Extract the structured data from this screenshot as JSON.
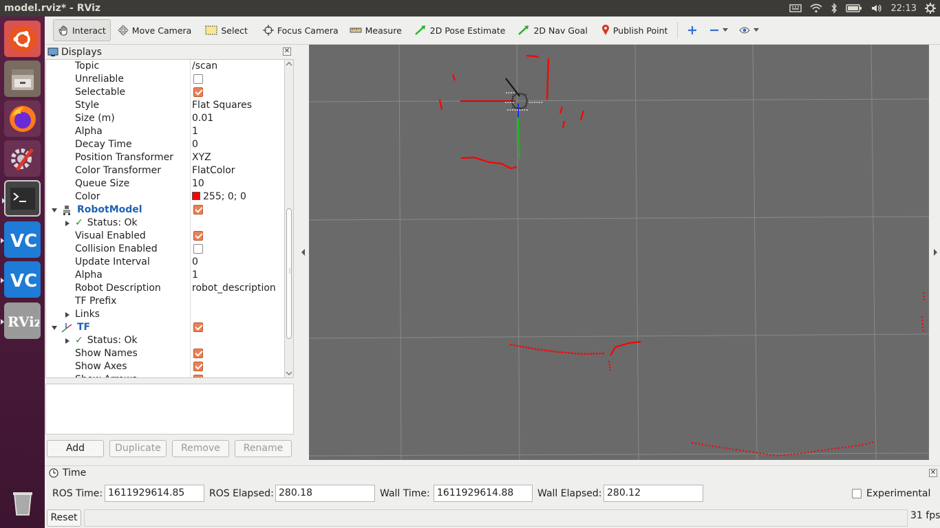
{
  "window": {
    "title": "model.rviz* - RViz"
  },
  "panel": {
    "clock": "22:13"
  },
  "toolbar": {
    "interact": "Interact",
    "move_camera": "Move Camera",
    "select": "Select",
    "focus_camera": "Focus Camera",
    "measure": "Measure",
    "pose_estimate": "2D Pose Estimate",
    "nav_goal": "2D Nav Goal",
    "publish_point": "Publish Point"
  },
  "displays": {
    "title": "Displays",
    "rows": [
      {
        "key": "Topic",
        "value": "/scan"
      },
      {
        "key": "Unreliable",
        "checked": false
      },
      {
        "key": "Selectable",
        "checked": true
      },
      {
        "key": "Style",
        "value": "Flat Squares"
      },
      {
        "key": "Size (m)",
        "value": "0.01"
      },
      {
        "key": "Alpha",
        "value": "1"
      },
      {
        "key": "Decay Time",
        "value": "0"
      },
      {
        "key": "Position Transformer",
        "value": "XYZ"
      },
      {
        "key": "Color Transformer",
        "value": "FlatColor"
      },
      {
        "key": "Queue Size",
        "value": "10"
      },
      {
        "key": "Color",
        "value": "255; 0; 0"
      },
      {
        "key": "RobotModel",
        "checked": true
      },
      {
        "key": "Status: Ok"
      },
      {
        "key": "Visual Enabled",
        "checked": true
      },
      {
        "key": "Collision Enabled",
        "checked": false
      },
      {
        "key": "Update Interval",
        "value": "0"
      },
      {
        "key": "Alpha",
        "value": "1"
      },
      {
        "key": "Robot Description",
        "value": "robot_description"
      },
      {
        "key": "TF Prefix",
        "value": ""
      },
      {
        "key": "Links"
      },
      {
        "key": "TF",
        "checked": true
      },
      {
        "key": "Status: Ok"
      },
      {
        "key": "Show Names",
        "checked": true
      },
      {
        "key": "Show Axes",
        "checked": true
      },
      {
        "key": "Show Arrows",
        "checked": true
      }
    ],
    "buttons": {
      "add": "Add",
      "duplicate": "Duplicate",
      "remove": "Remove",
      "rename": "Rename"
    }
  },
  "time": {
    "title": "Time",
    "ros_time_label": "ROS Time:",
    "ros_time": "1611929614.85",
    "ros_elapsed_label": "ROS Elapsed:",
    "ros_elapsed": "280.18",
    "wall_time_label": "Wall Time:",
    "wall_time": "1611929614.88",
    "wall_elapsed_label": "Wall Elapsed:",
    "wall_elapsed": "280.12",
    "experimental_label": "Experimental"
  },
  "status": {
    "reset": "Reset",
    "fps": "31 fps"
  },
  "colors": {
    "scan": "#ff0000",
    "grid_bg": "#6a6a6a",
    "check_on": "#ee7f53",
    "header_blue": "#1f62b5"
  }
}
